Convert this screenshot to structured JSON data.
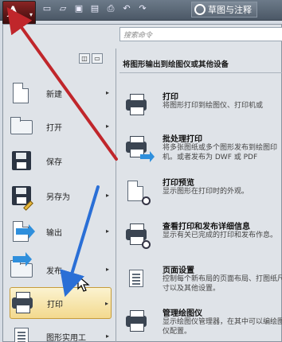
{
  "titlebar": {
    "quick_access_icons": [
      "new-icon",
      "open-icon",
      "save-icon",
      "saveas-icon",
      "print-icon",
      "undo-icon",
      "redo-icon"
    ],
    "workspace_label": "草图与注释"
  },
  "search": {
    "placeholder": "搜索命令"
  },
  "left_menu": {
    "items": [
      {
        "label": "新建",
        "icon": "new-document-icon"
      },
      {
        "label": "打开",
        "icon": "open-folder-icon"
      },
      {
        "label": "保存",
        "icon": "save-icon"
      },
      {
        "label": "另存为",
        "icon": "save-as-icon"
      },
      {
        "label": "输出",
        "icon": "export-icon"
      },
      {
        "label": "发布",
        "icon": "publish-icon"
      },
      {
        "label": "打印",
        "icon": "print-icon",
        "selected": true
      },
      {
        "label": "图形实用工",
        "icon": "drawing-utilities-icon"
      }
    ]
  },
  "right_panel": {
    "header": "将图形输出到绘图仪或其他设备",
    "items": [
      {
        "title": "打印",
        "desc": "将图形打印到绘图仪、打印机或",
        "icon": "printer-icon"
      },
      {
        "title": "批处理打印",
        "desc": "将多张图纸或多个图形发布到绘图印机。或者发布为 DWF 或 PDF",
        "icon": "batch-plot-icon"
      },
      {
        "title": "打印预览",
        "desc": "显示图形在打印时的外观。",
        "icon": "plot-preview-icon"
      },
      {
        "title": "查看打印和发布详细信息",
        "desc": "显示有关已完成的打印和发布作息。",
        "icon": "plot-details-icon"
      },
      {
        "title": "页面设置",
        "desc": "控制每个新布局的页面布局、打图纸尺寸以及其他设置。",
        "icon": "page-setup-icon"
      },
      {
        "title": "管理绘图仪",
        "desc": "显示绘图仪管理器，在其中可以编绘图仪配置。",
        "icon": "plotter-manager-icon"
      }
    ]
  },
  "colors": {
    "selection": "#f3d98e",
    "annotation_red": "#c0262b",
    "annotation_blue": "#2a6fd6"
  }
}
